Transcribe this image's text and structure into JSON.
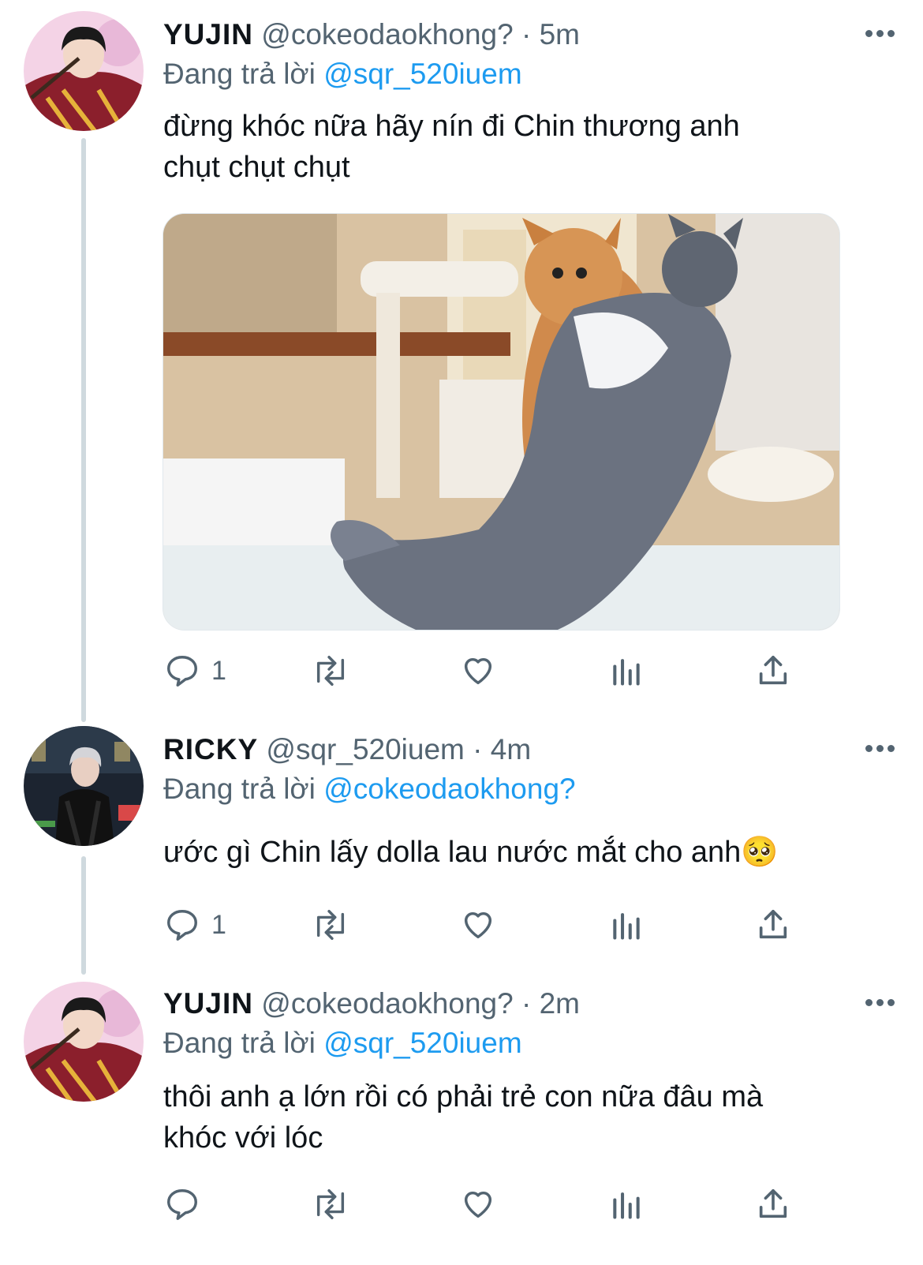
{
  "tweets": [
    {
      "display_name": "YUJIN",
      "handle": "@cokeodaokhong?",
      "separator": "·",
      "time": "5m",
      "reply_prefix": "Đang trả lời",
      "reply_to": "@sqr_520iuem",
      "text_lines": [
        "đừng khóc nữa hãy nín đi Chin thương anh",
        "chụt chụt chụt"
      ],
      "has_media": true,
      "reply_count": "1",
      "avatar": "yujin-avatar"
    },
    {
      "display_name": "RICKY",
      "handle": "@sqr_520iuem",
      "separator": "·",
      "time": "4m",
      "reply_prefix": "Đang trả lời",
      "reply_to": "@cokeodaokhong?",
      "text_lines": [
        "ước gì Chin lấy dolla lau nước mắt cho anh🥺"
      ],
      "has_media": false,
      "reply_count": "1",
      "avatar": "ricky-avatar"
    },
    {
      "display_name": "YUJIN",
      "handle": "@cokeodaokhong?",
      "separator": "·",
      "time": "2m",
      "reply_prefix": "Đang trả lời",
      "reply_to": "@sqr_520iuem",
      "text_lines": [
        "thôi anh ạ lớn rồi có phải trẻ con nữa đâu mà",
        "khóc với lóc"
      ],
      "has_media": false,
      "reply_count": "",
      "avatar": "yujin-avatar"
    }
  ],
  "icons": {
    "reply": "reply-icon",
    "retweet": "retweet-icon",
    "like": "heart-icon",
    "analytics": "analytics-icon",
    "share": "share-icon",
    "more": "more-options-icon"
  },
  "colors": {
    "accent": "#1d9bf0",
    "secondary_text": "#536471",
    "thread_line": "#cfd9de"
  }
}
